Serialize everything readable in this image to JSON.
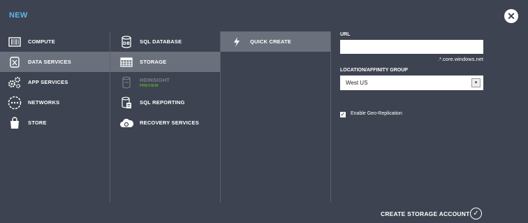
{
  "header": {
    "title": "NEW",
    "close_icon": "close-icon"
  },
  "categories": [
    {
      "label": "COMPUTE",
      "icon": "compute-icon"
    },
    {
      "label": "DATA SERVICES",
      "icon": "data-services-icon",
      "selected": true
    },
    {
      "label": "APP SERVICES",
      "icon": "gears-icon"
    },
    {
      "label": "NETWORKS",
      "icon": "network-icon"
    },
    {
      "label": "STORE",
      "icon": "shopping-bag-icon"
    }
  ],
  "data_services": [
    {
      "label": "SQL DATABASE",
      "icon": "database-icon"
    },
    {
      "label": "STORAGE",
      "icon": "storage-grid-icon",
      "selected": true
    },
    {
      "label": "HDINSIGHT",
      "sublabel": "PREVIEW",
      "icon": "hdinsight-icon",
      "disabled": true
    },
    {
      "label": "SQL REPORTING",
      "icon": "report-icon"
    },
    {
      "label": "RECOVERY SERVICES",
      "icon": "cloud-icon"
    }
  ],
  "create_options": [
    {
      "label": "QUICK CREATE",
      "icon": "lightning-icon",
      "selected": true
    }
  ],
  "form": {
    "url_label": "URL",
    "url_value": "",
    "url_suffix": ".*.core.windows.net",
    "location_label": "LOCATION/AFFINITY GROUP",
    "location_value": "West US",
    "geo_replication_label": "Enable Geo-Replication",
    "geo_replication_checked": true
  },
  "footer": {
    "create_label": "CREATE STORAGE ACCOUNT"
  },
  "colors": {
    "background": "#3d4350",
    "selected": "#6b717c",
    "accent": "#5fb6e8",
    "preview": "#58a83a"
  }
}
